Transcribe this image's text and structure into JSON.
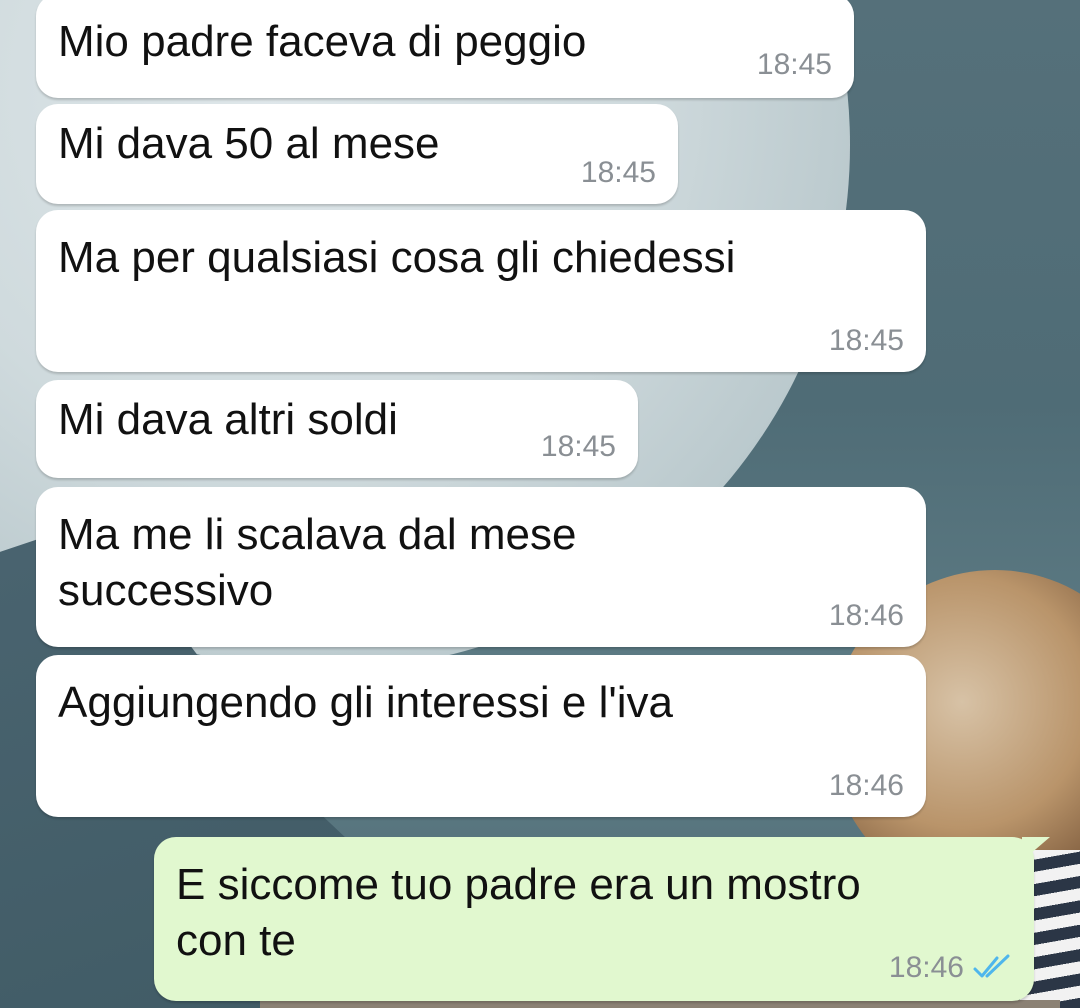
{
  "messages": [
    {
      "direction": "in",
      "text": "Mio padre faceva di peggio",
      "time": "18:45"
    },
    {
      "direction": "in",
      "text": "Mi dava 50 al mese",
      "time": "18:45"
    },
    {
      "direction": "in",
      "text": "Ma per qualsiasi cosa gli chiedessi",
      "time": "18:45"
    },
    {
      "direction": "in",
      "text": "Mi dava altri soldi",
      "time": "18:45"
    },
    {
      "direction": "in",
      "text": "Ma me li scalava dal mese\nsuccessivo",
      "time": "18:46"
    },
    {
      "direction": "in",
      "text": "Aggiungendo gli interessi e l'iva",
      "time": "18:46"
    },
    {
      "direction": "out",
      "text": "E siccome tuo padre era un mostro\ncon te",
      "time": "18:46",
      "status": "read"
    }
  ],
  "colors": {
    "incoming_bubble": "#ffffff",
    "outgoing_bubble": "#e1f8cf",
    "read_tick": "#4fb6ec",
    "timestamp": "#8a8f94"
  },
  "icons": {
    "read_receipt": "double-check-icon"
  }
}
